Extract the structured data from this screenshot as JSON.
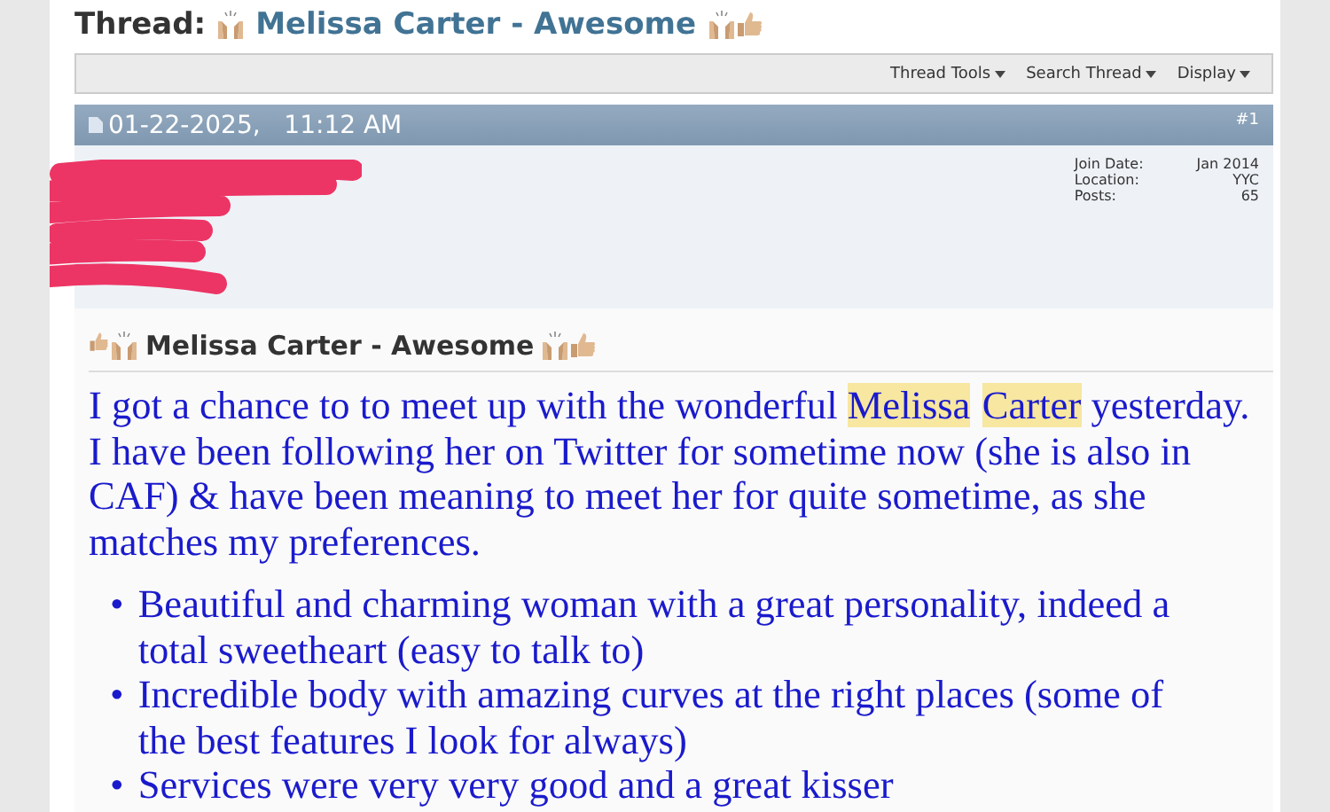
{
  "thread": {
    "prefix": "Thread:",
    "title": "Melissa Carter - Awesome"
  },
  "toolbar": [
    {
      "label": "Thread Tools"
    },
    {
      "label": "Search Thread"
    },
    {
      "label": "Display"
    }
  ],
  "post": {
    "date": "01-22-2025,",
    "time": "11:12 AM",
    "number": "#1",
    "user_info": [
      {
        "label": "Join Date:",
        "value": "Jan 2014"
      },
      {
        "label": "Location:",
        "value": "YYC"
      },
      {
        "label": "Posts:",
        "value": "65"
      }
    ],
    "title": "Melissa Carter - Awesome",
    "paragraphs": [
      [
        {
          "text": "I got a chance to to meet up with the wonderful ",
          "highlighted": false
        },
        {
          "text": "Melissa",
          "highlighted": true
        },
        {
          "text": "Carter",
          "highlighted": true
        },
        {
          "text": " yesterday.",
          "highlighted": false
        }
      ],
      [
        {
          "text": "I have been following her on Twitter for sometime now (she is also in CAF) & have been meaning to meet her for quite sometime, as she matches my preferences.",
          "highlighted": false
        }
      ]
    ],
    "bullets": [
      {
        "marker": "•",
        "text": "Beautiful and charming woman with a great personality, indeed a total sweetheart (easy to talk to)"
      },
      {
        "marker": "•",
        "text": "Incredible body with amazing curves at the right places (some of the best features I look for always)"
      },
      {
        "marker": "•",
        "text": "Services were very very good and a great kisser"
      }
    ]
  }
}
